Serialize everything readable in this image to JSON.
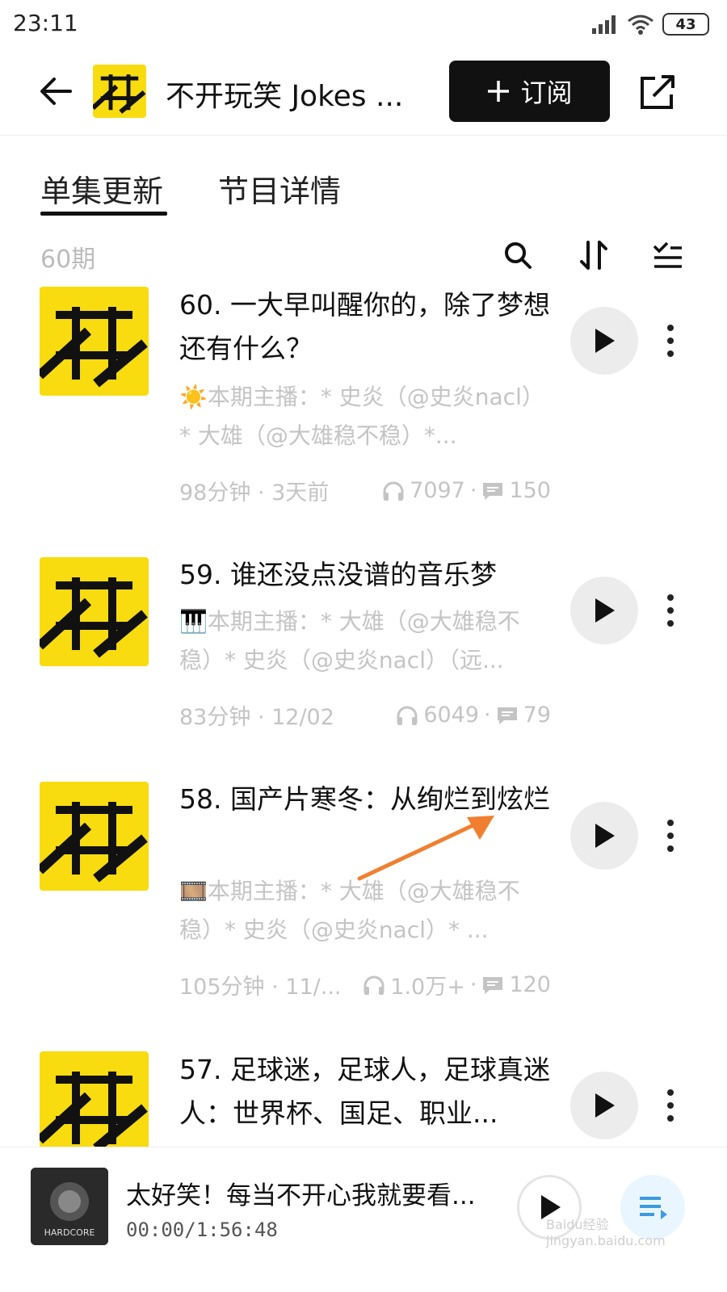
{
  "status_bar": {
    "time": "23:11",
    "battery": "43"
  },
  "header": {
    "logo_text": "不开玩笑",
    "title": "不开玩笑 Jokes ...",
    "subscribe_label": "订阅"
  },
  "tabs": [
    {
      "label": "单集更新"
    },
    {
      "label": "节目详情"
    }
  ],
  "list": {
    "count": "60期"
  },
  "episodes": [
    {
      "title": "60. 一大早叫醒你的，除了梦想还有什么？",
      "description": "☀️本期主播：* 史炎（@史炎nacl）* 大雄（@大雄稳不稳）*...",
      "duration_date": "98分钟 · 3天前",
      "plays": "7097",
      "comments": "150"
    },
    {
      "title": "59. 谁还没点没谱的音乐梦",
      "description": "🎹本期主播：* 大雄（@大雄稳不稳）* 史炎（@史炎nacl）（远...",
      "duration_date": "83分钟 · 12/02",
      "plays": "6049",
      "comments": "79"
    },
    {
      "title": "58. 国产片寒冬：从绚烂到炫烂",
      "description": "🎞️本期主播：* 大雄（@大雄稳不稳）* 史炎（@史炎nacl）* ...",
      "duration_date": "105分钟 · 11/...",
      "plays": "1.0万+",
      "comments": "120"
    },
    {
      "title": "57. 足球迷，足球人，足球真迷人：世界杯、国足、职业...",
      "description": "",
      "duration_date": "",
      "plays": "",
      "comments": ""
    }
  ],
  "player": {
    "cover_text": "HARDCORE",
    "title": "太好笑！每当不开心我就要看...",
    "time": "00:00/1:56:48"
  },
  "watermark": "Baidu经验 jingyan.baidu.com",
  "colors": {
    "logo_yellow": "#f8dc10",
    "annotation_arrow": "#f08030"
  }
}
